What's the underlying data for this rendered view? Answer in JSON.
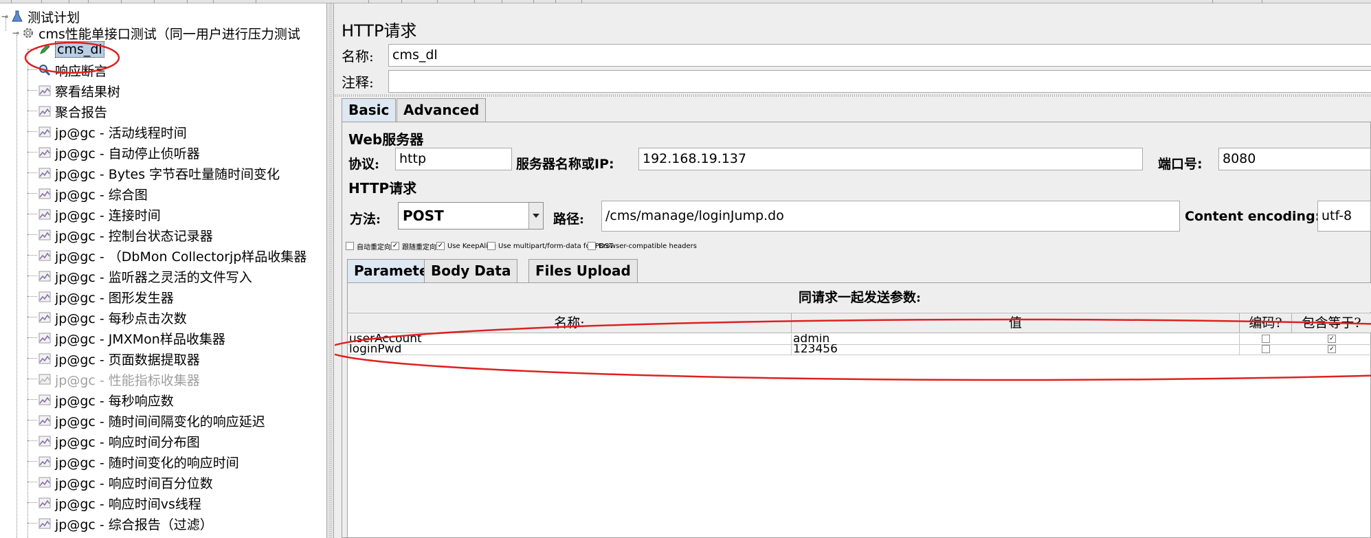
{
  "tree": {
    "root_label": "测试计划",
    "thread_group_label": "cms性能单接口测试（同一用户进行压力测试",
    "selected_label": "cms_dl",
    "items": [
      {
        "label": "响应断言",
        "icon": "search-icon",
        "dim": false
      },
      {
        "label": "察看结果树",
        "icon": "chart-icon",
        "dim": false
      },
      {
        "label": "聚合报告",
        "icon": "chart-icon",
        "dim": false
      },
      {
        "label": "jp@gc - 活动线程时间",
        "icon": "chart-icon",
        "dim": false
      },
      {
        "label": "jp@gc - 自动停止侦听器",
        "icon": "chart-icon",
        "dim": false
      },
      {
        "label": "jp@gc - Bytes 字节吞吐量随时间变化",
        "icon": "chart-icon",
        "dim": false
      },
      {
        "label": "jp@gc - 综合图",
        "icon": "chart-icon",
        "dim": false
      },
      {
        "label": "jp@gc - 连接时间",
        "icon": "chart-icon",
        "dim": false
      },
      {
        "label": "jp@gc - 控制台状态记录器",
        "icon": "chart-icon",
        "dim": false
      },
      {
        "label": "jp@gc - （DbMon Collectorjp样品收集器",
        "icon": "chart-icon",
        "dim": false
      },
      {
        "label": "jp@gc - 监听器之灵活的文件写入",
        "icon": "chart-icon",
        "dim": false
      },
      {
        "label": "jp@gc - 图形发生器",
        "icon": "chart-icon",
        "dim": false
      },
      {
        "label": "jp@gc - 每秒点击次数",
        "icon": "chart-icon",
        "dim": false
      },
      {
        "label": "jp@gc - JMXMon样品收集器",
        "icon": "chart-icon",
        "dim": false
      },
      {
        "label": "jp@gc - 页面数据提取器",
        "icon": "chart-icon",
        "dim": false
      },
      {
        "label": "jp@gc - 性能指标收集器",
        "icon": "chart-icon",
        "dim": true
      },
      {
        "label": "jp@gc - 每秒响应数",
        "icon": "chart-icon",
        "dim": false
      },
      {
        "label": "jp@gc - 随时间间隔变化的响应延迟",
        "icon": "chart-icon",
        "dim": false
      },
      {
        "label": "jp@gc - 响应时间分布图",
        "icon": "chart-icon",
        "dim": false
      },
      {
        "label": "jp@gc - 随时间变化的响应时间",
        "icon": "chart-icon",
        "dim": false
      },
      {
        "label": "jp@gc - 响应时间百分位数",
        "icon": "chart-icon",
        "dim": false
      },
      {
        "label": "jp@gc - 响应时间vs线程",
        "icon": "chart-icon",
        "dim": false
      },
      {
        "label": "jp@gc - 综合报告（过滤）",
        "icon": "chart-icon",
        "dim": false
      }
    ]
  },
  "panel": {
    "title": "HTTP请求",
    "name_label": "名称:",
    "name_value": "cms_dl",
    "comment_label": "注释:",
    "comment_value": "",
    "tabs": [
      "Basic",
      "Advanced"
    ],
    "web_server": {
      "title": "Web服务器",
      "protocol_label": "协议:",
      "protocol_value": "http",
      "server_label": "服务器名称或IP:",
      "server_value": "192.168.19.137",
      "port_label": "端口号:",
      "port_value": "8080"
    },
    "http_request": {
      "title": "HTTP请求",
      "method_label": "方法:",
      "method_value": "POST",
      "path_label": "路径:",
      "path_value": "/cms/manage/loginJump.do",
      "encoding_label": "Content encoding:",
      "encoding_value": "utf-8"
    },
    "options": [
      {
        "label": "自动重定向",
        "checked": false
      },
      {
        "label": "跟随重定向",
        "checked": true
      },
      {
        "label": "Use KeepAlive",
        "checked": true
      },
      {
        "label": "Use multipart/form-data for POST",
        "checked": false
      },
      {
        "label": "Browser-compatible headers",
        "checked": false
      }
    ],
    "param_tabs": [
      "Parameters",
      "Body Data",
      "Files Upload"
    ],
    "params_caption": "同请求一起发送参数:",
    "columns": [
      "名称:",
      "值",
      "编码?",
      "包含等于?"
    ],
    "rows": [
      {
        "name": "userAccount",
        "value": "admin",
        "encode": false,
        "include_equals": true
      },
      {
        "name": "loginPwd",
        "value": "123456",
        "encode": false,
        "include_equals": true
      }
    ]
  },
  "colors": {
    "annotation": "#e02020",
    "selection": "#b8cfe5"
  }
}
